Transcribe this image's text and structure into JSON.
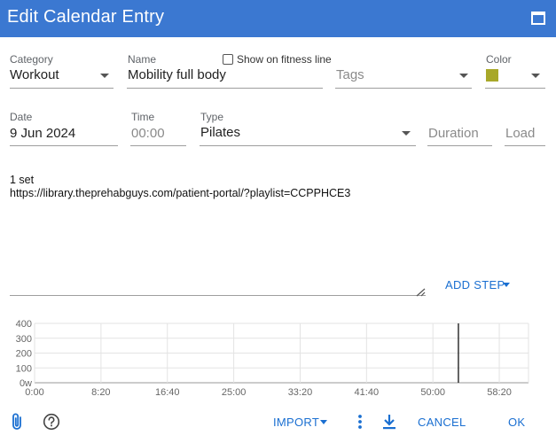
{
  "dialog": {
    "title": "Edit Calendar Entry"
  },
  "category": {
    "label": "Category",
    "value": "Workout"
  },
  "name": {
    "label": "Name",
    "value": "Mobility full body"
  },
  "fitness_line": {
    "label": "Show on fitness line",
    "checked": false
  },
  "tags": {
    "placeholder": "Tags"
  },
  "color": {
    "label": "Color",
    "value": "#a8a829"
  },
  "date": {
    "label": "Date",
    "value": "9 Jun 2024"
  },
  "time": {
    "label": "Time",
    "value": "00:00"
  },
  "type": {
    "label": "Type",
    "value": "Pilates"
  },
  "duration": {
    "placeholder": "Duration"
  },
  "load": {
    "placeholder": "Load"
  },
  "description": {
    "line1": "1 set",
    "line2": "https://library.theprehabguys.com/patient-portal/?playlist=CCPPHCE3"
  },
  "add_step_label": "ADD STEP",
  "chart_data": {
    "type": "line",
    "y_ticks": [
      "400",
      "300",
      "200",
      "100",
      "0w"
    ],
    "ylim": [
      0,
      400
    ],
    "x_ticks": [
      "0:00",
      "8:20",
      "16:40",
      "25:00",
      "33:20",
      "41:40",
      "50:00",
      "58:20"
    ],
    "xlim_minutes": [
      0,
      62
    ],
    "marker_at_minutes": 53.2,
    "grid": true
  },
  "footer": {
    "import_label": "IMPORT",
    "cancel_label": "CANCEL",
    "ok_label": "OK"
  },
  "icons": {
    "maximize": "maximize-icon",
    "attachment": "paperclip-icon",
    "help": "help-circle-icon",
    "more": "more-vert-icon",
    "download": "download-icon"
  },
  "colors": {
    "header": "#3b78d1",
    "accent": "#1a6fd1",
    "swatch": "#a8a829"
  }
}
